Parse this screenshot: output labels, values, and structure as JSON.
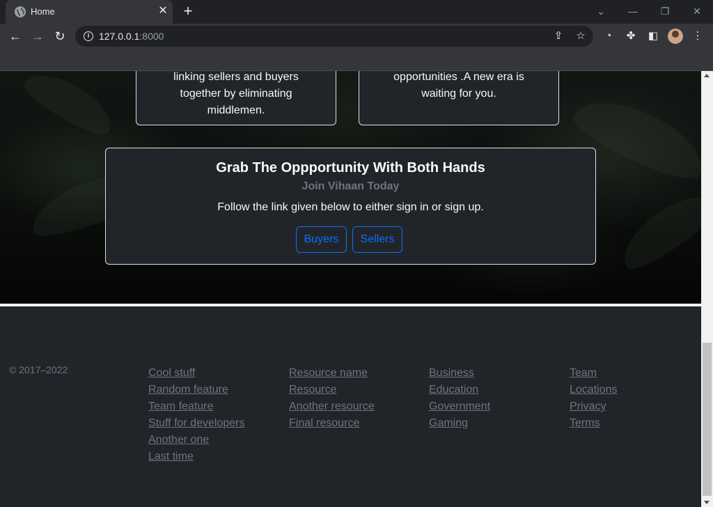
{
  "browser": {
    "tab_title": "Home",
    "tab_close": "✕",
    "new_tab": "+",
    "url_host": "127.0.0.1",
    "url_port": ":8000"
  },
  "hero": {
    "card_left_text": [
      "linking sellers and buyers",
      "together by eliminating",
      "middlemen."
    ],
    "card_right_text": [
      "opportunities .A new era is",
      "waiting for you."
    ],
    "main_card": {
      "title": "Grab The Oppportunity With Both Hands",
      "subtitle": "Join Vihaan Today",
      "text": "Follow the link given below to either sign in or sign up.",
      "buyers_label": "Buyers",
      "sellers_label": "Sellers"
    }
  },
  "footer": {
    "copyright": "© 2017–2022",
    "columns": [
      [
        "Cool stuff",
        "Random feature",
        "Team feature",
        "Stuff for developers",
        "Another one",
        "Last time"
      ],
      [
        "Resource name",
        "Resource",
        "Another resource",
        "Final resource"
      ],
      [
        "Business",
        "Education",
        "Government",
        "Gaming"
      ],
      [
        "Team",
        "Locations",
        "Privacy",
        "Terms"
      ]
    ]
  },
  "colors": {
    "accent": "#0d6efd",
    "footer_bg": "#212529",
    "muted": "#6c757d"
  }
}
